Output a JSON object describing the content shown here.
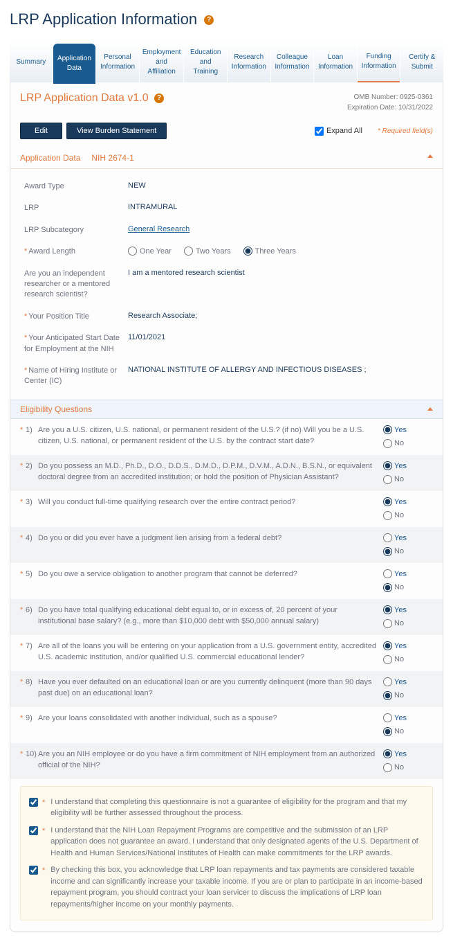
{
  "page_title": "LRP Application Information",
  "tabs": [
    {
      "label": "Summary"
    },
    {
      "label": "Application Data"
    },
    {
      "label": "Personal Information"
    },
    {
      "label": "Employment and Affiliation"
    },
    {
      "label": "Education and Training"
    },
    {
      "label": "Research Information"
    },
    {
      "label": "Colleague Information"
    },
    {
      "label": "Loan Information"
    },
    {
      "label": "Funding Information"
    },
    {
      "label": "Certify & Submit"
    }
  ],
  "panel_title": "LRP Application Data v1.0",
  "omb": "OMB Number: 0925-0361",
  "exp": "Expiration Date: 10/31/2022",
  "btn_edit": "Edit",
  "btn_burden": "View Burden Statement",
  "expand_label": "Expand All",
  "required_note": "* Required field(s)",
  "crumb1": "Application Data",
  "crumb2": "NIH 2674-1",
  "fields": {
    "award_type": {
      "label": "Award Type",
      "value": "NEW"
    },
    "lrp": {
      "label": "LRP",
      "value": "INTRAMURAL"
    },
    "subcat": {
      "label": "LRP Subcategory",
      "value": "General Research"
    },
    "length": {
      "label": "Award Length",
      "opt1": "One Year",
      "opt2": "Two Years",
      "opt3": "Three Years"
    },
    "researcher": {
      "label": "Are you an independent researcher or a mentored research scientist?",
      "value": "I am a mentored research scientist"
    },
    "position": {
      "label": "Your Position Title",
      "value": "Research Associate;"
    },
    "start_date": {
      "label": "Your Anticipated Start Date for Employment at the NIH",
      "value": "11/01/2021"
    },
    "institute": {
      "label": "Name of Hiring Institute or Center (IC)",
      "value": "NATIONAL INSTITUTE OF ALLERGY AND INFECTIOUS DISEASES ;"
    }
  },
  "eligibility_hdr": "Eligibility Questions",
  "yes": "Yes",
  "no": "No",
  "questions": [
    {
      "n": "1)",
      "t": "Are you a U.S. citizen, U.S. national, or permanent resident of the U.S.? (if no) Will you be a U.S. citizen, U.S. national, or permanent resident of the U.S. by the contract start date?",
      "a": "yes"
    },
    {
      "n": "2)",
      "t": "Do you possess an M.D., Ph.D., D.O., D.D.S., D.M.D., D.P.M., D.V.M., A.D.N., B.S.N., or equivalent doctoral degree from an accredited institution; or hold the position of Physician Assistant?",
      "a": "yes"
    },
    {
      "n": "3)",
      "t": "Will you conduct full-time qualifying research over the entire contract period?",
      "a": "yes"
    },
    {
      "n": "4)",
      "t": "Do you or did you ever have a judgment lien arising from a federal debt?",
      "a": "no"
    },
    {
      "n": "5)",
      "t": "Do you owe a service obligation to another program that cannot be deferred?",
      "a": "no"
    },
    {
      "n": "6)",
      "t": "Do you have total qualifying educational debt equal to, or in excess of, 20 percent of your institutional base salary? (e.g., more than $10,000 debt with $50,000 annual salary)",
      "a": "yes"
    },
    {
      "n": "7)",
      "t": "Are all of the loans you will be entering on your application from a U.S. government entity, accredited U.S. academic institution, and/or qualified U.S. commercial educational lender?",
      "a": "yes"
    },
    {
      "n": "8)",
      "t": "Have you ever defaulted on an educational loan or are you currently delinquent (more than 90 days past due) on an educational loan?",
      "a": "no"
    },
    {
      "n": "9)",
      "t": "Are your loans consolidated with another individual, such as a spouse?",
      "a": "no"
    },
    {
      "n": "10)",
      "t": "Are you an NIH employee or do you have a firm commitment of NIH employment from an authorized official of the NIH?",
      "a": "yes"
    }
  ],
  "ack": [
    "I understand that completing this questionnaire is not a guarantee of eligibility for the program and that my eligibility will be further assessed throughout the process.",
    "I understand that the NIH Loan Repayment Programs are competitive and the submission of an LRP application does not guarantee an award. I understand that only designated agents of the U.S. Department of Health and Human Services/National Institutes of Health can make commitments for the LRP awards.",
    "By checking this box, you acknowledge that LRP loan repayments and tax payments are considered taxable income and can significantly increase your taxable income. If you are or plan to participate in an income-based repayment program, you should contract your loan servicer to discuss the implications of LRP loan repayments/higher income on your monthly payments."
  ]
}
